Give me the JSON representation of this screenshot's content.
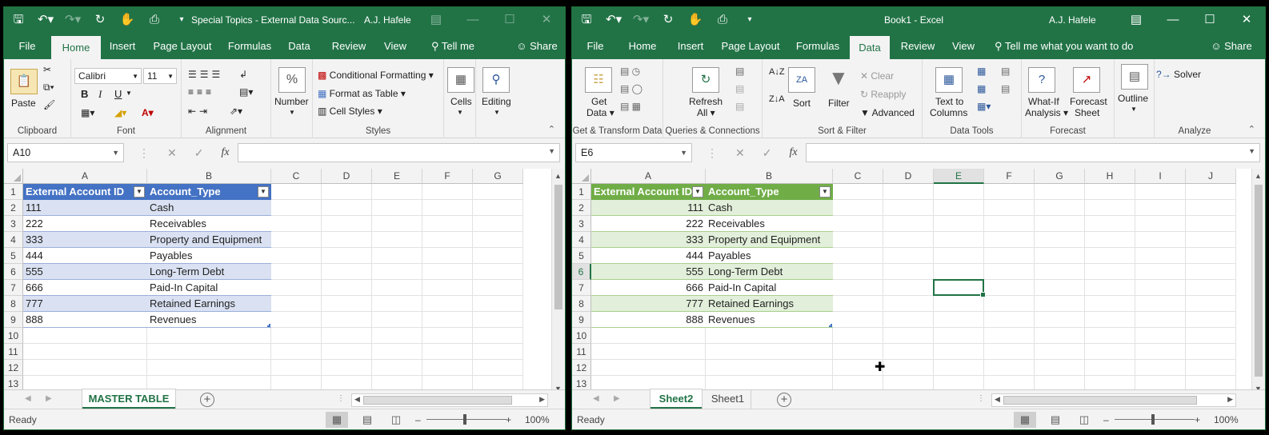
{
  "colors": {
    "excel_green": "#217346",
    "table1_header": "#4472c4",
    "table1_band": "#d9e1f2",
    "table2_header": "#70ad47",
    "table2_band": "#e2efda"
  },
  "w1": {
    "title": "Special Topics - External Data Sourc...",
    "user": "A.J. Hafele",
    "menu": [
      "File",
      "Home",
      "Insert",
      "Page Layout",
      "Formulas",
      "Data",
      "Review",
      "View"
    ],
    "tell_me": "Tell me",
    "share": "Share",
    "ribbon": {
      "paste": "Paste",
      "clipboard": "Clipboard",
      "font_name": "Calibri",
      "font_size": "11",
      "font": "Font",
      "bold": "B",
      "italic": "I",
      "underline": "U",
      "alignment": "Alignment",
      "number_symbol": "%",
      "number": "Number",
      "cond_format": "Conditional Formatting",
      "format_table": "Format as Table",
      "cell_styles": "Cell Styles",
      "styles": "Styles",
      "cells": "Cells",
      "editing": "Editing"
    },
    "namebox": "A10",
    "columns": [
      "A",
      "B",
      "C",
      "D",
      "E",
      "F",
      "G"
    ],
    "rows": [
      "1",
      "2",
      "3",
      "4",
      "5",
      "6",
      "7",
      "8",
      "9",
      "10",
      "11",
      "12",
      "13"
    ],
    "headers": [
      "External Account ID",
      "Account_Type"
    ],
    "ids": [
      "111",
      "222",
      "333",
      "444",
      "555",
      "666",
      "777",
      "888"
    ],
    "types": [
      "Cash",
      "Receivables",
      "Property and Equipment",
      "Payables",
      "Long-Term Debt",
      "Paid-In Capital",
      "Retained Earnings",
      "Revenues"
    ],
    "sheet_tabs": [
      "MASTER TABLE"
    ],
    "status": "Ready",
    "zoom": "100%"
  },
  "w2": {
    "title": "Book1 - Excel",
    "user": "A.J. Hafele",
    "menu": [
      "File",
      "Home",
      "Insert",
      "Page Layout",
      "Formulas",
      "Data",
      "Review",
      "View"
    ],
    "tell_me": "Tell me what you want to do",
    "share": "Share",
    "ribbon": {
      "get_data": "Get",
      "get_data2": "Data",
      "get_transform": "Get & Transform Data",
      "refresh": "Refresh",
      "refresh2": "All",
      "queries": "Queries & Connections",
      "sort": "Sort",
      "filter": "Filter",
      "clear": "Clear",
      "reapply": "Reapply",
      "advanced": "Advanced",
      "sort_filter": "Sort & Filter",
      "text_cols": "Text to",
      "text_cols2": "Columns",
      "data_tools": "Data Tools",
      "whatif": "What-If",
      "whatif2": "Analysis",
      "forecast_sheet": "Forecast",
      "forecast_sheet2": "Sheet",
      "forecast": "Forecast",
      "outline": "Outline",
      "solver": "Solver",
      "analyze": "Analyze"
    },
    "namebox": "E6",
    "columns": [
      "A",
      "B",
      "C",
      "D",
      "E",
      "F",
      "G",
      "H",
      "I",
      "J"
    ],
    "rows": [
      "1",
      "2",
      "3",
      "4",
      "5",
      "6",
      "7",
      "8",
      "9",
      "10",
      "11",
      "12",
      "13"
    ],
    "headers": [
      "External Account ID",
      "Account_Type"
    ],
    "ids": [
      "111",
      "222",
      "333",
      "444",
      "555",
      "666",
      "777",
      "888"
    ],
    "types": [
      "Cash",
      "Receivables",
      "Property and Equipment",
      "Payables",
      "Long-Term Debt",
      "Paid-In Capital",
      "Retained Earnings",
      "Revenues"
    ],
    "sheet_tabs": [
      "Sheet2",
      "Sheet1"
    ],
    "status": "Ready",
    "zoom": "100%"
  }
}
